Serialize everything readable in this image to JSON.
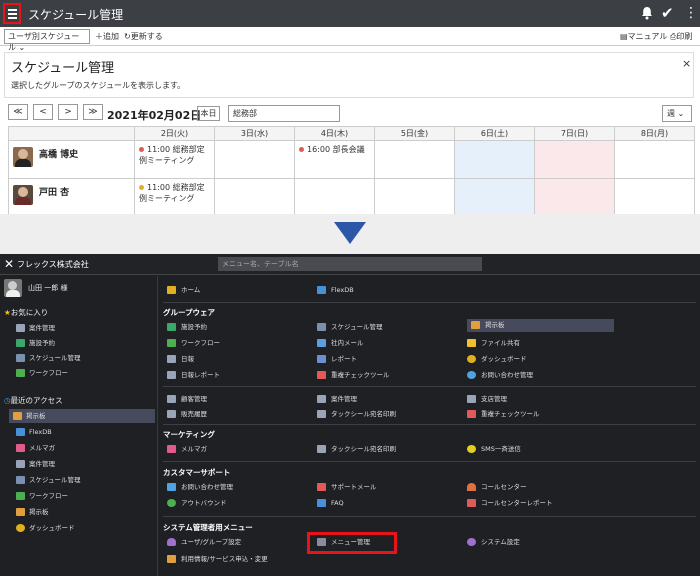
{
  "top": {
    "header": {
      "title": "スケジュール管理"
    },
    "toolbar": {
      "view_select": "ユーザ別スケジュール",
      "add_label": "追加",
      "refresh_label": "更新する",
      "manual_label": "マニュアル",
      "print_label": "印刷"
    },
    "panel": {
      "title": "スケジュール管理",
      "description": "選択したグループのスケジュールを表示します。",
      "close": "×"
    },
    "nav": {
      "first": "≪",
      "prev": "<",
      "next": ">",
      "last": "≫",
      "date": "2021年02月02日",
      "today": "本日",
      "group": "総務部",
      "range": "週"
    },
    "schedule": {
      "days": [
        "2日(火)",
        "3日(水)",
        "4日(木)",
        "5日(金)",
        "6日(土)",
        "7日(日)",
        "8日(月)"
      ],
      "rows": [
        {
          "name": "高橋 博史",
          "events": {
            "d0": {
              "text": "11:00 総務部定例ミーティング",
              "color": "#e05a5a"
            },
            "d2": {
              "text": "16:00 部長会議",
              "color": "#e05a5a"
            }
          }
        },
        {
          "name": "戸田 杏",
          "events": {
            "d0": {
              "text": "11:00 総務部定例ミーティング",
              "color": "#e0b020"
            }
          }
        }
      ]
    }
  },
  "bottom": {
    "header": {
      "company": "フレックス株式会社",
      "search_placeholder": "メニュー名、テーブル名"
    },
    "sidebar": {
      "user": "山田 一郎 様",
      "favorites_title": "お気に入り",
      "favorites": [
        "案件管理",
        "施設予約",
        "スケジュール管理",
        "ワークフロー"
      ],
      "recent_title": "最近のアクセス",
      "recent": [
        "掲示板",
        "FlexDB",
        "メルマガ",
        "案件管理",
        "スケジュール管理",
        "ワークフロー",
        "掲示板",
        "ダッシュボード"
      ]
    },
    "menu": {
      "home": "ホーム",
      "flexdb": "FlexDB",
      "groupware_title": "グループウェア",
      "groupware": [
        "施設予約",
        "スケジュール管理",
        "掲示板",
        "ワークフロー",
        "社内メール",
        "ファイル共有",
        "日報",
        "レポート",
        "ダッシュボード",
        "日報レポート",
        "重複チェックツール",
        "お問い合わせ管理"
      ],
      "biz": [
        "顧客管理",
        "案件管理",
        "支店管理",
        "販売履歴",
        "タックシール宛名印刷",
        "重複チェックツール"
      ],
      "marketing_title": "マーケティング",
      "marketing": [
        "メルマガ",
        "タックシール宛名印刷",
        "SMS一斉送信"
      ],
      "support_title": "カスタマーサポート",
      "support": [
        "お問い合わせ管理",
        "サポートメール",
        "コールセンター",
        "アウトバウンド",
        "FAQ",
        "コールセンターレポート"
      ],
      "admin_title": "システム管理者用メニュー",
      "admin": [
        "ユーザ/グループ設定",
        "メニュー管理",
        "システム設定",
        "利用情報/サービス申込・変更"
      ]
    }
  }
}
